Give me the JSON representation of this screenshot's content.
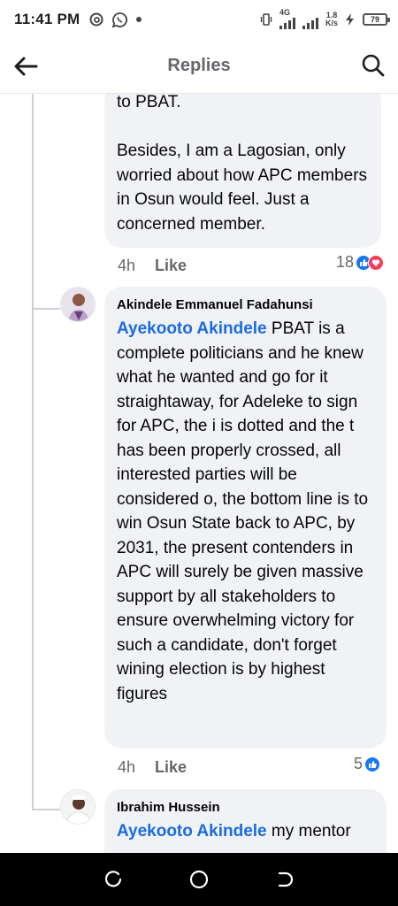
{
  "status_bar": {
    "time": "11:41 PM",
    "network_label": "4G",
    "speed_value": "1.8",
    "speed_unit": "K/s",
    "battery": "79",
    "icons": [
      "threads-icon",
      "whatsapp-icon",
      "notification-dot-icon",
      "vibrate-icon",
      "signal-icon",
      "signal-icon",
      "charging-icon",
      "battery-icon"
    ]
  },
  "header": {
    "title": "Replies",
    "back_icon": "arrow-left-icon",
    "search_icon": "search-icon"
  },
  "comments": [
    {
      "text": "to PBAT.\n\nBesides, I am a Lagosian, only worried about how APC members in Osun would feel. Just a concerned member.",
      "time": "4h",
      "like_label": "Like",
      "reaction_count": "18",
      "reactions": [
        "like-reaction-icon",
        "love-reaction-icon"
      ]
    },
    {
      "author": "Akindele Emmanuel Fadahunsi",
      "mention": "Ayekooto Akindele",
      "text": "PBAT is a complete politicians and he knew what he wanted and go for it straightaway, for Adeleke to sign for APC, the i is dotted and the t has been properly crossed, all interested parties will be considered o, the bottom line is to win Osun State back to APC, by 2031, the present contenders in APC will surely be given massive support by all stakeholders to ensure overwhelming victory for such a candidate, don't forget wining election is by highest figures",
      "time": "4h",
      "like_label": "Like",
      "reaction_count": "5",
      "reactions": [
        "like-reaction-icon"
      ]
    },
    {
      "author": "Ibrahim Hussein",
      "mention": "Ayekooto Akindele",
      "text": "my mentor"
    }
  ],
  "navbar": {
    "icons": [
      "recent-apps-icon",
      "home-icon",
      "back-icon"
    ]
  },
  "colors": {
    "mention_blue": "#1a6ce0",
    "bubble_gray": "#f0f2f5",
    "like_blue": "#1877f2",
    "love_red": "#f33e58"
  }
}
